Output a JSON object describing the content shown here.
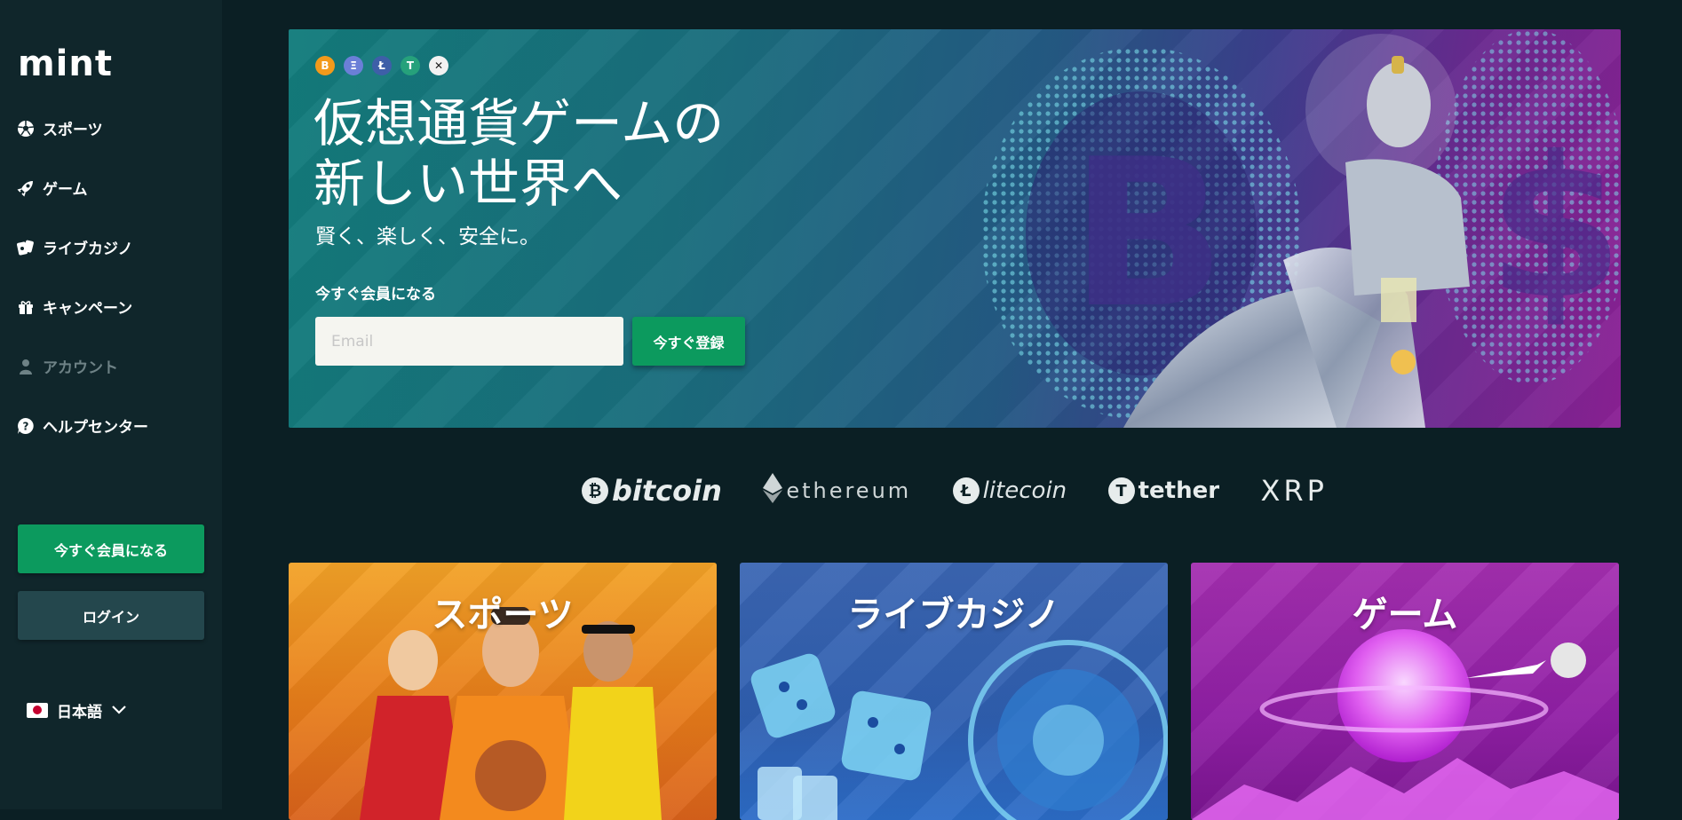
{
  "brand": {
    "logo_text": "mint"
  },
  "sidebar": {
    "items": [
      {
        "label": "スポーツ",
        "icon": "soccer-ball-icon"
      },
      {
        "label": "ゲーム",
        "icon": "rocket-icon"
      },
      {
        "label": "ライブカジノ",
        "icon": "cards-icon"
      },
      {
        "label": "キャンペーン",
        "icon": "gift-icon"
      },
      {
        "label": "アカウント",
        "icon": "user-icon"
      },
      {
        "label": "ヘルプセンター",
        "icon": "help-icon"
      }
    ],
    "register_label": "今すぐ会員になる",
    "login_label": "ログイン",
    "language": "日本語"
  },
  "hero": {
    "coins": [
      "B",
      "Ξ",
      "Ł",
      "T",
      "✕"
    ],
    "title_line1": "仮想通貨ゲームの",
    "title_line2": "新しい世界へ",
    "subtitle": "賢く、楽しく、安全に。",
    "cta_label": "今すぐ会員になる",
    "email_placeholder": "Email",
    "email_value": "",
    "register_button": "今すぐ登録"
  },
  "brands": {
    "bitcoin": "bitcoin",
    "ethereum": "ethereum",
    "litecoin": "litecoin",
    "tether": "tether",
    "xrp": "XRP"
  },
  "categories": [
    {
      "title": "スポーツ"
    },
    {
      "title": "ライブカジノ"
    },
    {
      "title": "ゲーム"
    }
  ],
  "colors": {
    "accent_green": "#0c9a5e",
    "sidebar_bg": "#10262b",
    "page_bg": "#0b1f24"
  }
}
